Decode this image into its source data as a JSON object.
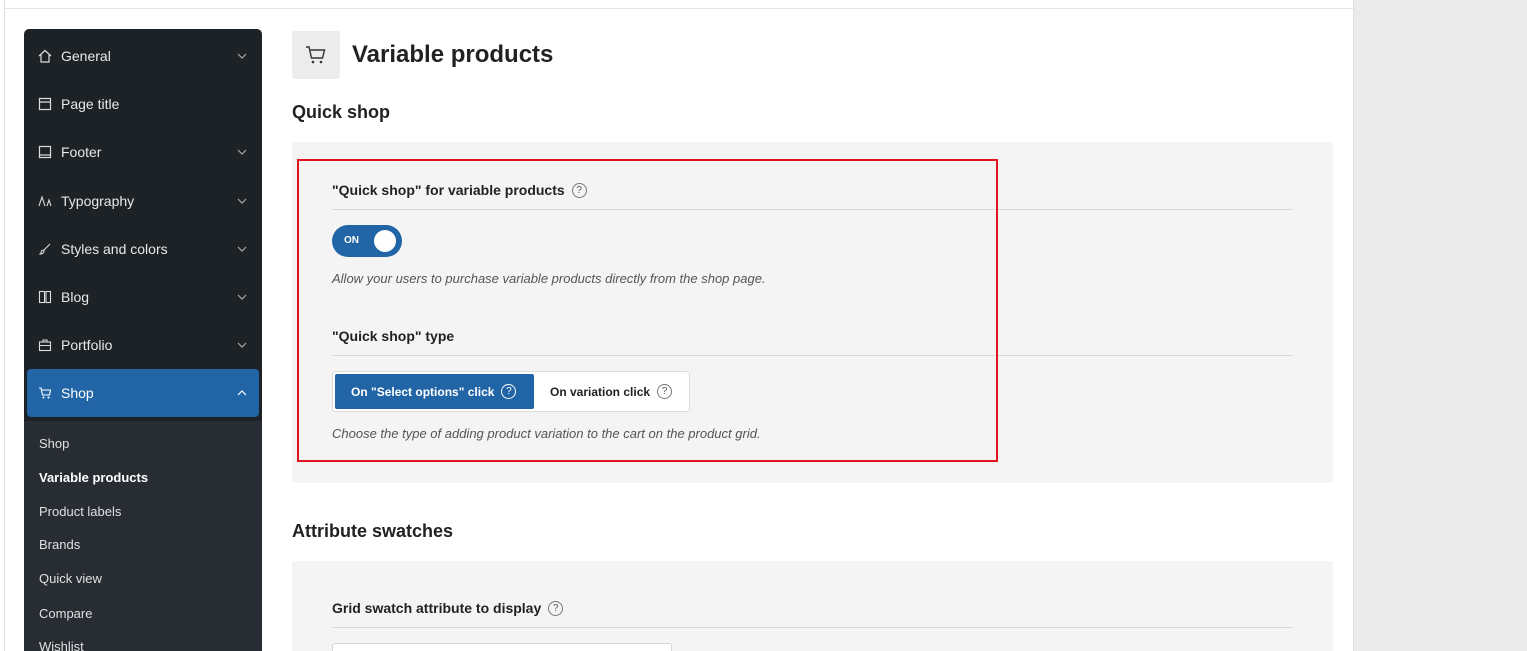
{
  "sidebar": {
    "items": [
      {
        "label": "General",
        "icon": "home-icon",
        "expandable": true
      },
      {
        "label": "Page title",
        "icon": "page-icon",
        "expandable": false
      },
      {
        "label": "Footer",
        "icon": "footer-icon",
        "expandable": true
      },
      {
        "label": "Typography",
        "icon": "typography-icon",
        "expandable": true
      },
      {
        "label": "Styles and colors",
        "icon": "brush-icon",
        "expandable": true
      },
      {
        "label": "Blog",
        "icon": "blog-icon",
        "expandable": true
      },
      {
        "label": "Portfolio",
        "icon": "briefcase-icon",
        "expandable": true
      },
      {
        "label": "Shop",
        "icon": "cart-icon",
        "expandable": true,
        "active": true
      }
    ],
    "submenu": [
      "Shop",
      "Variable products",
      "Product labels",
      "Brands",
      "Quick view",
      "Compare",
      "Wishlist"
    ],
    "current_sub": "Variable products"
  },
  "page": {
    "title": "Variable products",
    "icon": "cart-icon"
  },
  "quick_shop": {
    "section_title": "Quick shop",
    "enable_label": "\"Quick shop\" for variable products",
    "toggle_state": "ON",
    "enable_desc": "Allow your users to purchase variable products directly from the shop page.",
    "type_label": "\"Quick shop\" type",
    "type_options": [
      "On \"Select options\" click",
      "On variation click"
    ],
    "type_selected": "On \"Select options\" click",
    "type_desc": "Choose the type of adding product variation to the cart on the product grid."
  },
  "swatches": {
    "section_title": "Attribute swatches",
    "grid_label": "Grid swatch attribute to display"
  },
  "colors": {
    "accent": "#2165a6",
    "sidebar_bg": "#1d2226",
    "highlight": "#e0141e"
  }
}
